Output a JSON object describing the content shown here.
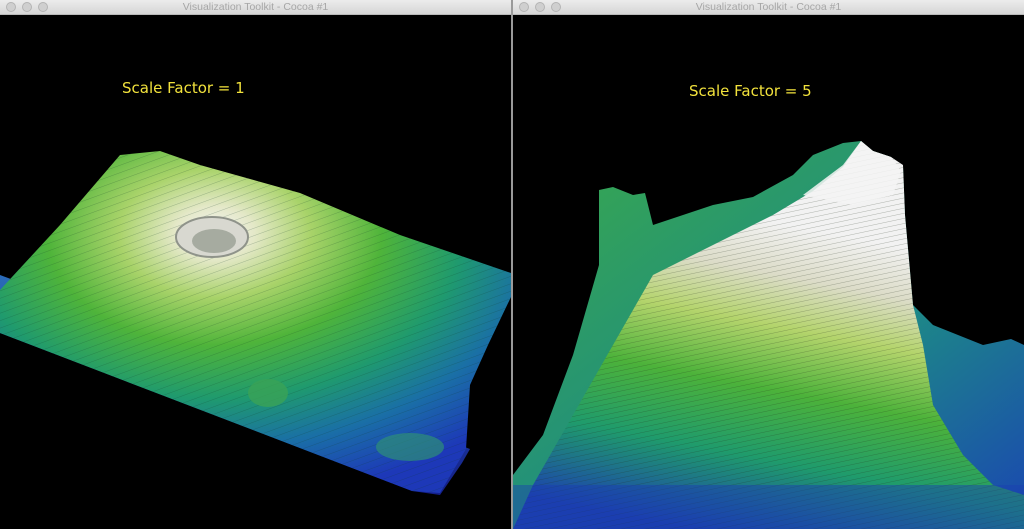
{
  "windows": {
    "left": {
      "title": "Visualization Toolkit - Cocoa #1",
      "label": "Scale Factor = 1"
    },
    "right": {
      "title": "Visualization Toolkit - Cocoa #1",
      "label": "Scale Factor = 5"
    }
  },
  "colors": {
    "background": "#000000",
    "label": "#f2e23c",
    "terrain_low": "#1d3fbf",
    "terrain_mid": "#3fae3a",
    "terrain_high": "#f0f0f0"
  }
}
